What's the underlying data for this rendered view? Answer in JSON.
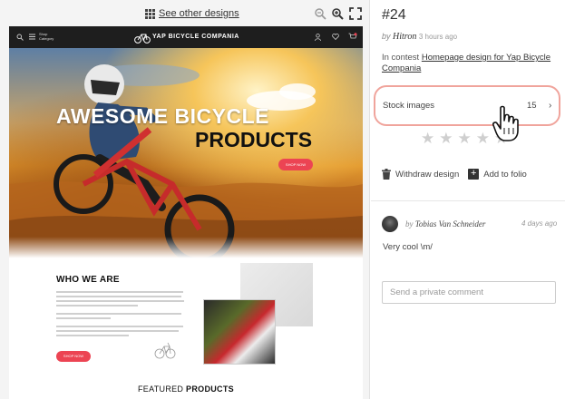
{
  "toolbar": {
    "see_other_label": "See other designs",
    "icons": [
      "grid-icon",
      "zoom-out-icon",
      "zoom-in-icon",
      "fullscreen-icon"
    ]
  },
  "preview": {
    "nav": {
      "shop_line1": "Shop",
      "shop_line2": "Category",
      "brand": "YAP BICYCLE COMPANIA"
    },
    "hero": {
      "title_line1": "AWESOME BICYCLE",
      "title_line2": "PRODUCTS",
      "button": "SHOP NOW"
    },
    "who": {
      "title": "WHO WE ARE",
      "button": "SHOP NOW"
    },
    "featured": {
      "prefix": "FEATURED",
      "bold": "PRODUCTS"
    }
  },
  "panel": {
    "design_number": "#24",
    "byline": {
      "by": "by",
      "user": "Hitron",
      "time": "3 hours ago"
    },
    "contest": {
      "prefix": "In contest",
      "link": "Homepage design for Yap Bicycle Compania"
    },
    "stock": {
      "label": "Stock images",
      "count": "15"
    },
    "rating": {
      "stars": 5,
      "filled": 0
    },
    "actions": {
      "withdraw": "Withdraw design",
      "add_to_folio": "Add to folio"
    },
    "comment": {
      "by": "by",
      "author": "Tobias Van Schneider",
      "time": "4 days ago",
      "text": "Very cool \\m/"
    },
    "private_comment": {
      "placeholder": "Send a private comment",
      "value": ""
    }
  },
  "colors": {
    "accent_red": "#ec4453",
    "highlight_ring": "#f0a49c",
    "star_empty": "#cfcfcf"
  }
}
